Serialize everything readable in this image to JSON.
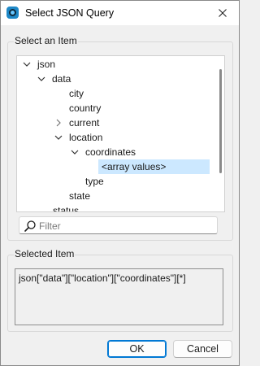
{
  "window": {
    "title": "Select JSON Query",
    "accent": "#0078d4"
  },
  "select_group": {
    "label": "Select an Item",
    "tree": [
      {
        "label": "json",
        "expanded": true
      },
      {
        "label": "data",
        "expanded": true
      },
      {
        "label": "city"
      },
      {
        "label": "country"
      },
      {
        "label": "current",
        "expanded": false
      },
      {
        "label": "location",
        "expanded": true
      },
      {
        "label": "coordinates",
        "expanded": true
      },
      {
        "label": "<array values>",
        "selected": true
      },
      {
        "label": "type"
      },
      {
        "label": "state"
      },
      {
        "label": "status"
      }
    ]
  },
  "filter": {
    "placeholder": "Filter",
    "value": ""
  },
  "selected_group": {
    "label": "Selected Item",
    "value": "json[\"data\"][\"location\"][\"coordinates\"][*]"
  },
  "buttons": {
    "ok": "OK",
    "cancel": "Cancel"
  }
}
